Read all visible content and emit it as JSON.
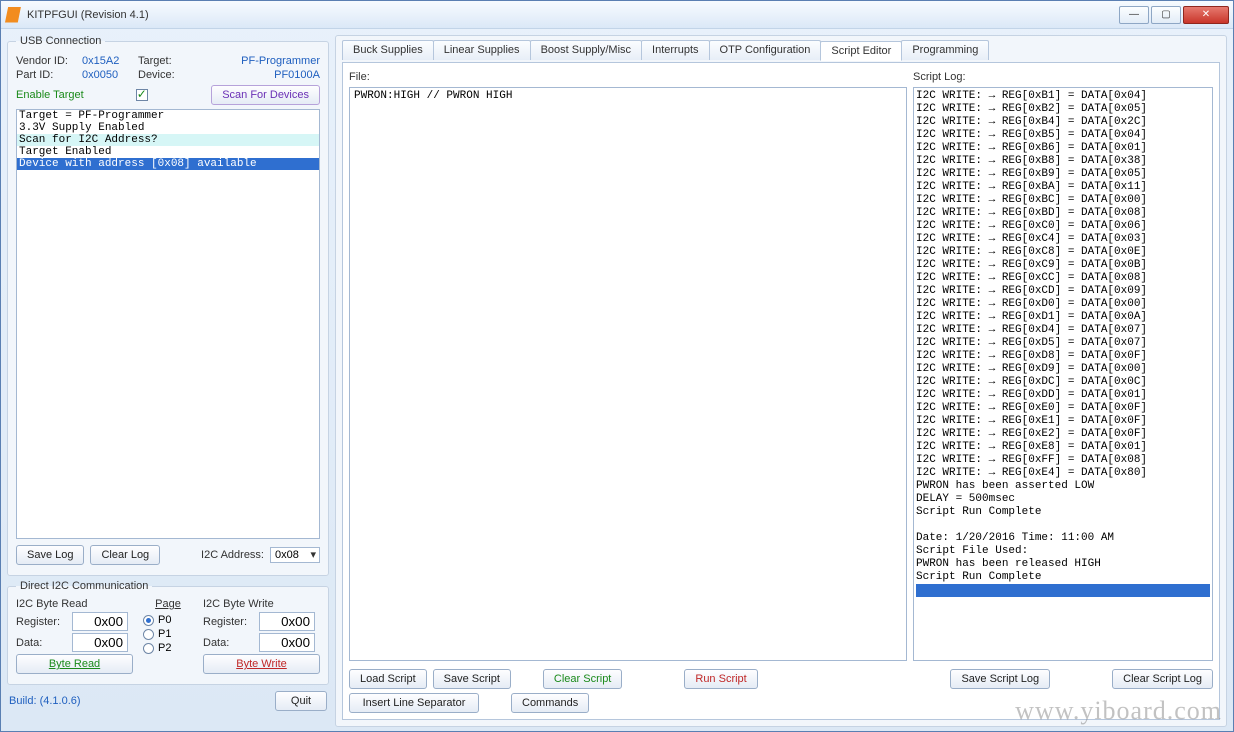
{
  "window": {
    "title": "KITPFGUI (Revision 4.1)"
  },
  "winbtns": {
    "min": "—",
    "max": "▢",
    "close": "✕"
  },
  "usb": {
    "legend": "USB Connection",
    "vendor_lbl": "Vendor ID:",
    "vendor_val": "0x15A2",
    "target_lbl": "Target:",
    "target_val": "PF-Programmer",
    "part_lbl": "Part ID:",
    "part_val": "0x0050",
    "device_lbl": "Device:",
    "device_val": "PF0100A",
    "enable_target_lbl": "Enable Target",
    "scan_btn": "Scan For Devices"
  },
  "conn_log": [
    "Target = PF-Programmer",
    "3.3V Supply Enabled",
    "Scan for I2C Address?",
    "Target Enabled",
    "Device with address [0x08] available"
  ],
  "log_btns": {
    "save": "Save Log",
    "clear": "Clear Log",
    "i2c_addr_lbl": "I2C Address:",
    "i2c_addr_val": "0x08"
  },
  "i2c": {
    "legend": "Direct I2C Communication",
    "read_legend": "I2C Byte Read",
    "write_legend": "I2C Byte Write",
    "page_lbl": "Page",
    "register_lbl": "Register:",
    "data_lbl": "Data:",
    "read_register": "0x00",
    "read_data": "0x00",
    "write_register": "0x00",
    "write_data": "0x00",
    "p0": "P0",
    "p1": "P1",
    "p2": "P2",
    "read_btn": "Byte Read",
    "write_btn": "Byte Write"
  },
  "footer": {
    "build": "Build: (4.1.0.6)",
    "quit": "Quit"
  },
  "tabs": {
    "items": [
      "Buck Supplies",
      "Linear Supplies",
      "Boost Supply/Misc",
      "Interrupts",
      "OTP Configuration",
      "Script Editor",
      "Programming"
    ],
    "active": 5
  },
  "editor": {
    "file_lbl": "File:",
    "content": "PWRON:HIGH // PWRON HIGH"
  },
  "scriptlog": {
    "label": "Script Log:",
    "lines": [
      "I2C WRITE: → REG[0xB1] = DATA[0x04]",
      "I2C WRITE: → REG[0xB2] = DATA[0x05]",
      "I2C WRITE: → REG[0xB4] = DATA[0x2C]",
      "I2C WRITE: → REG[0xB5] = DATA[0x04]",
      "I2C WRITE: → REG[0xB6] = DATA[0x01]",
      "I2C WRITE: → REG[0xB8] = DATA[0x38]",
      "I2C WRITE: → REG[0xB9] = DATA[0x05]",
      "I2C WRITE: → REG[0xBA] = DATA[0x11]",
      "I2C WRITE: → REG[0xBC] = DATA[0x00]",
      "I2C WRITE: → REG[0xBD] = DATA[0x08]",
      "I2C WRITE: → REG[0xC0] = DATA[0x06]",
      "I2C WRITE: → REG[0xC4] = DATA[0x03]",
      "I2C WRITE: → REG[0xC8] = DATA[0x0E]",
      "I2C WRITE: → REG[0xC9] = DATA[0x0B]",
      "I2C WRITE: → REG[0xCC] = DATA[0x08]",
      "I2C WRITE: → REG[0xCD] = DATA[0x09]",
      "I2C WRITE: → REG[0xD0] = DATA[0x00]",
      "I2C WRITE: → REG[0xD1] = DATA[0x0A]",
      "I2C WRITE: → REG[0xD4] = DATA[0x07]",
      "I2C WRITE: → REG[0xD5] = DATA[0x07]",
      "I2C WRITE: → REG[0xD8] = DATA[0x0F]",
      "I2C WRITE: → REG[0xD9] = DATA[0x00]",
      "I2C WRITE: → REG[0xDC] = DATA[0x0C]",
      "I2C WRITE: → REG[0xDD] = DATA[0x01]",
      "I2C WRITE: → REG[0xE0] = DATA[0x0F]",
      "I2C WRITE: → REG[0xE1] = DATA[0x0F]",
      "I2C WRITE: → REG[0xE2] = DATA[0x0F]",
      "I2C WRITE: → REG[0xE8] = DATA[0x01]",
      "I2C WRITE: → REG[0xFF] = DATA[0x08]",
      "I2C WRITE: → REG[0xE4] = DATA[0x80]",
      "PWRON has been asserted LOW",
      "DELAY = 500msec",
      "Script Run Complete",
      "",
      "Date: 1/20/2016 Time: 11:00 AM",
      "Script File Used:",
      "PWRON has been released HIGH",
      "Script Run Complete"
    ]
  },
  "script_btns": {
    "load": "Load Script",
    "save": "Save Script",
    "clear": "Clear Script",
    "run": "Run Script",
    "insert_sep": "Insert Line Separator",
    "commands": "Commands",
    "save_log": "Save Script Log",
    "clear_log": "Clear Script Log"
  },
  "watermark": "www.yiboard.com"
}
